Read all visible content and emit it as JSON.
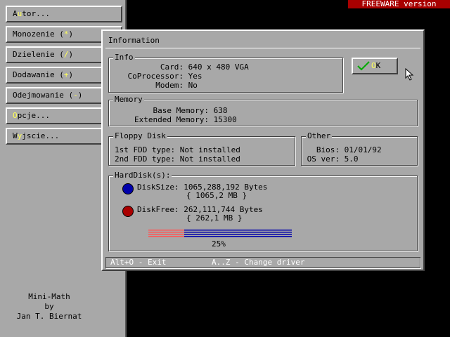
{
  "menu": {
    "items": [
      {
        "pre": "A",
        "hot": "u",
        "post": "tor..."
      },
      {
        "pre": "Monozenie (",
        "hot": "*",
        "post": ")"
      },
      {
        "pre": "Dzielenie (",
        "hot": "/",
        "post": ")"
      },
      {
        "pre": "Dodawanie (",
        "hot": "+",
        "post": ")"
      },
      {
        "pre": "Odejmowanie (",
        "hot": "-",
        "post": ")"
      },
      {
        "pre": "",
        "hot": "O",
        "post": "pcje..."
      },
      {
        "pre": "W",
        "hot": "y",
        "post": "jscie..."
      }
    ],
    "credits": [
      "Mini-Math",
      "by",
      "Jan T. Biernat"
    ]
  },
  "freeware_label": "FREEWARE version",
  "dialog": {
    "title": "Information",
    "info": {
      "label": "Info",
      "card_key": "Card:",
      "card_val": "640 x 480 VGA",
      "cop_key": "CoProcessor:",
      "cop_val": "Yes",
      "modem_key": "Modem:",
      "modem_val": "No"
    },
    "ok_button": {
      "pre": "",
      "hot": "O",
      "post": "K"
    },
    "memory": {
      "label": "Memory",
      "base_key": "Base Memory:",
      "base_val": "638",
      "ext_key": "Extended Memory:",
      "ext_val": "15300"
    },
    "floppy": {
      "label": "Floppy Disk",
      "fdd1_key": "1st FDD type:",
      "fdd1_val": "Not installed",
      "fdd2_key": "2nd FDD type:",
      "fdd2_val": "Not installed"
    },
    "other": {
      "label": "Other",
      "bios_key": "Bios:",
      "bios_val": "01/01/92",
      "os_key": "OS ver:",
      "os_val": "5.0"
    },
    "harddisk": {
      "label": "HardDisk(s):",
      "size_line1": "DiskSize: 1065,288,192 Bytes",
      "size_line2": "{ 1065,2 MB }",
      "free_line1": "DiskFree: 262,111,744 Bytes",
      "free_line2": "{ 262,1 MB }",
      "usage_percent": 25,
      "usage_label": "25%"
    },
    "status": {
      "exit": "Alt+O - Exit",
      "driver": "A..Z - Change driver"
    }
  },
  "colors": {
    "face": "#a8a8a8",
    "size_dot": "#0000aa",
    "free_dot": "#aa0000",
    "bar_free": "#ff5555",
    "bar_used": "#0000aa",
    "hotkey": "#ffff55"
  }
}
